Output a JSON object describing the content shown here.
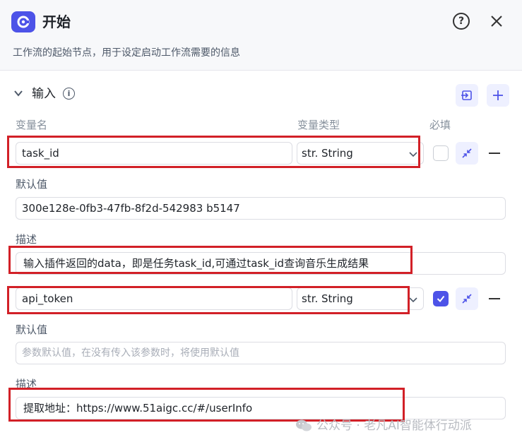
{
  "header": {
    "title": "开始",
    "subtitle": "工作流的起始节点，用于设定启动工作流需要的信息",
    "help_glyph": "?"
  },
  "section": {
    "title": "输入",
    "info_glyph": "i"
  },
  "columns": {
    "name": "变量名",
    "type": "变量类型",
    "required": "必填"
  },
  "variables": [
    {
      "name": "task_id",
      "type": "str. String",
      "required": false,
      "default_label": "默认值",
      "default_value": "300e128e-0fb3-47fb-8f2d-542983 b5147",
      "description_label": "描述",
      "description_value": "输入插件返回的data，即是任务task_id,可通过task_id查询音乐生成结果"
    },
    {
      "name": "api_token",
      "type": "str. String",
      "required": true,
      "default_label": "默认值",
      "default_placeholder": "参数默认值，在没有传入该参数时，将使用默认值",
      "description_label": "描述",
      "description_value": "提取地址：https://www.51aigc.cc/#/userInfo"
    }
  ],
  "watermark": "公众号 · 老凡AI智能体行动派",
  "colors": {
    "accent": "#4d53e8",
    "highlight": "#d22027"
  }
}
